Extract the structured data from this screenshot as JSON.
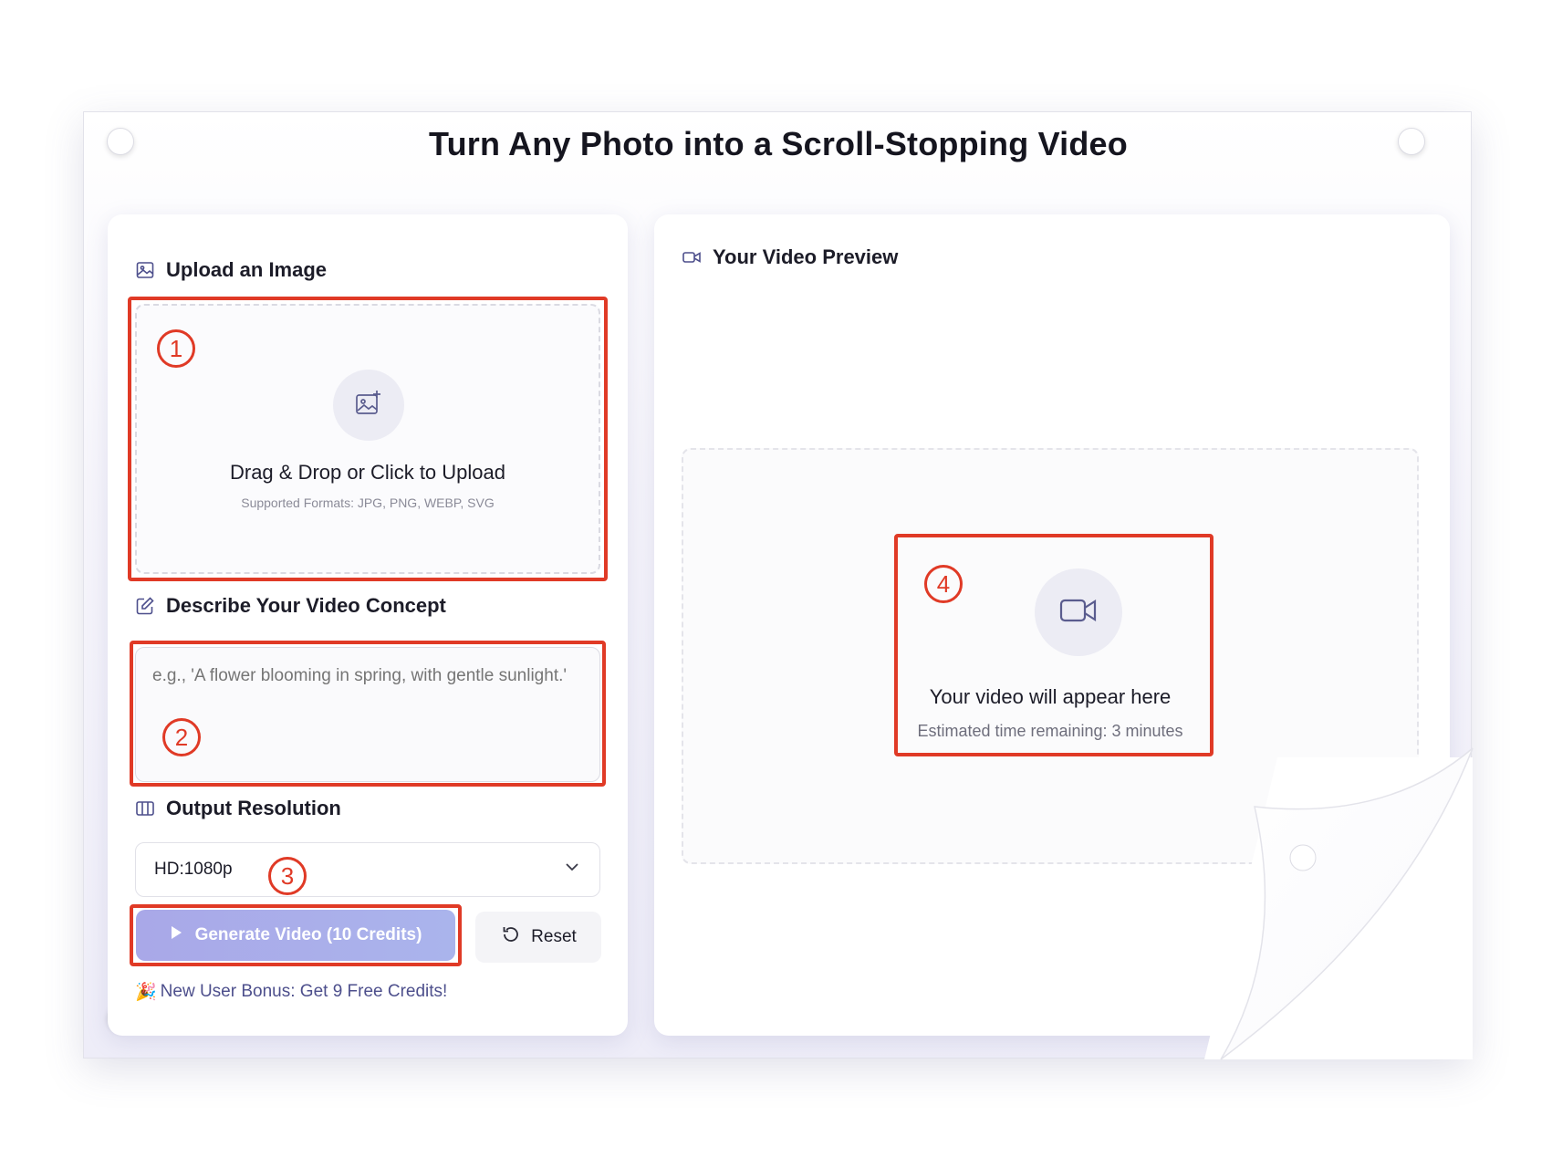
{
  "page": {
    "title": "Turn Any Photo into a Scroll-Stopping Video"
  },
  "upload": {
    "heading": "Upload an Image",
    "dropzone_title": "Drag & Drop or Click to Upload",
    "dropzone_formats": "Supported Formats: JPG, PNG, WEBP, SVG"
  },
  "concept": {
    "heading": "Describe Your Video Concept",
    "placeholder": "e.g., 'A flower blooming in spring, with gentle sunlight.'"
  },
  "resolution": {
    "heading": "Output Resolution",
    "selected": "HD:1080p"
  },
  "actions": {
    "generate_label": "Generate Video (10 Credits)",
    "reset_label": "Reset"
  },
  "bonus": {
    "emoji": "🎉",
    "text": "New User Bonus: Get 9 Free Credits!"
  },
  "preview": {
    "heading": "Your Video Preview",
    "placeholder_title": "Your video will appear here",
    "eta": "Estimated time remaining: 3 minutes"
  },
  "annotations": {
    "step1": "1",
    "step2": "2",
    "step3": "3",
    "step4": "4",
    "color": "#e03a26"
  },
  "colors": {
    "accent": "#4d4f8c",
    "button_gradient_start": "#a9a8e8",
    "button_gradient_end": "#aab4ec"
  }
}
